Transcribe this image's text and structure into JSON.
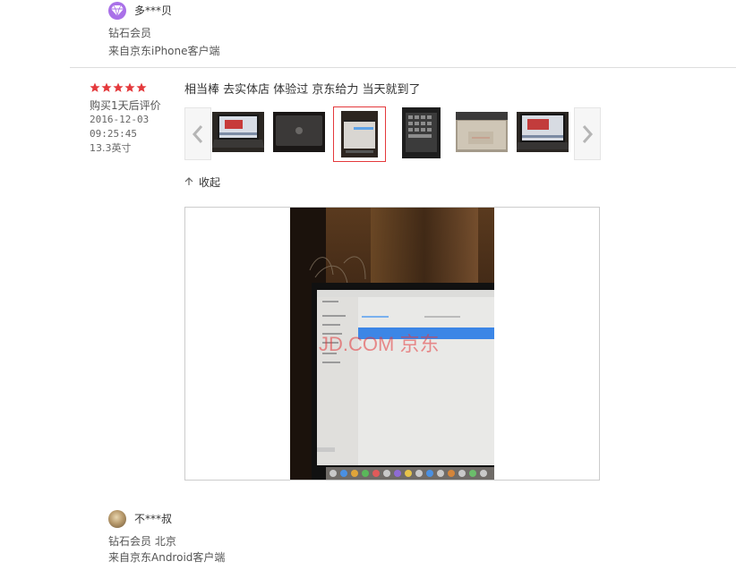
{
  "review_top": {
    "username": "多***贝",
    "member_level": "钻石会员",
    "client": "来自京东iPhone客户端",
    "avatar_icon": "diamond-icon"
  },
  "review_main": {
    "rating": 5,
    "after_days": "购买1天后评价",
    "date": "2016-12-03",
    "time": "09:25:45",
    "spec": "13.3英寸",
    "comment": "相当棒 去实体店 体验过 京东给力 当天就到了",
    "thumbnail_count": 6,
    "selected_thumbnail": 3,
    "collapse_label": "收起",
    "watermark": "JD.COM 京东",
    "colors": {
      "star": "#e4393c",
      "selected_border": "#e4393c",
      "avatar_diamond": "#a970e8"
    }
  },
  "review_bottom": {
    "username": "不***叔",
    "member_level": "钻石会员 北京",
    "client": "来自京东Android客户端"
  }
}
